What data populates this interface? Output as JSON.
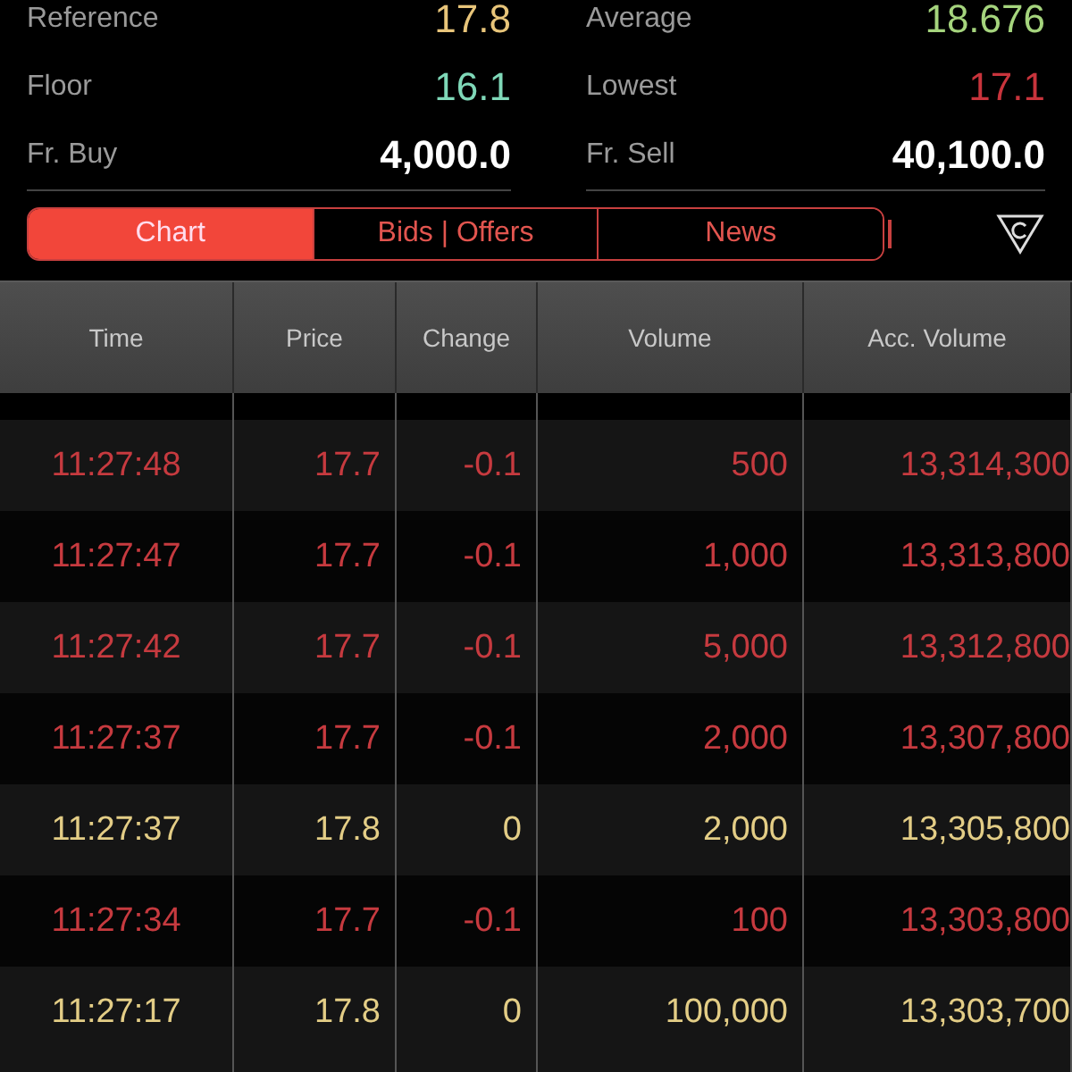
{
  "stats": [
    {
      "label": "Reference",
      "value": "17.8",
      "kind": "reference"
    },
    {
      "label": "Average",
      "value": "18.676",
      "kind": "up"
    },
    {
      "label": "Floor",
      "value": "16.1",
      "kind": "floor"
    },
    {
      "label": "Lowest",
      "value": "17.1",
      "kind": "down"
    },
    {
      "label": "Fr. Buy",
      "value": "4,000.0",
      "kind": "plain"
    },
    {
      "label": "Fr. Sell",
      "value": "40,100.0",
      "kind": "plain"
    }
  ],
  "tabs": [
    {
      "label": "Chart",
      "selected": true
    },
    {
      "label": "Bids | Offers",
      "selected": false
    },
    {
      "label": "News",
      "selected": false
    }
  ],
  "table": {
    "columns": [
      "Time",
      "Price",
      "Change",
      "Volume",
      "Acc. Volume"
    ],
    "rows": [
      {
        "kind": "down",
        "cells": [
          "11:27:48",
          "17.7",
          "-0.1",
          "500",
          "13,314,300"
        ]
      },
      {
        "kind": "down",
        "cells": [
          "11:27:47",
          "17.7",
          "-0.1",
          "1,000",
          "13,313,800"
        ]
      },
      {
        "kind": "down",
        "cells": [
          "11:27:42",
          "17.7",
          "-0.1",
          "5,000",
          "13,312,800"
        ]
      },
      {
        "kind": "down",
        "cells": [
          "11:27:37",
          "17.7",
          "-0.1",
          "2,000",
          "13,307,800"
        ]
      },
      {
        "kind": "unchanged",
        "cells": [
          "11:27:37",
          "17.8",
          "0",
          "2,000",
          "13,305,800"
        ]
      },
      {
        "kind": "down",
        "cells": [
          "11:27:34",
          "17.7",
          "-0.1",
          "100",
          "13,303,800"
        ]
      },
      {
        "kind": "unchanged",
        "cells": [
          "11:27:17",
          "17.8",
          "0",
          "100,000",
          "13,303,700"
        ]
      }
    ]
  }
}
